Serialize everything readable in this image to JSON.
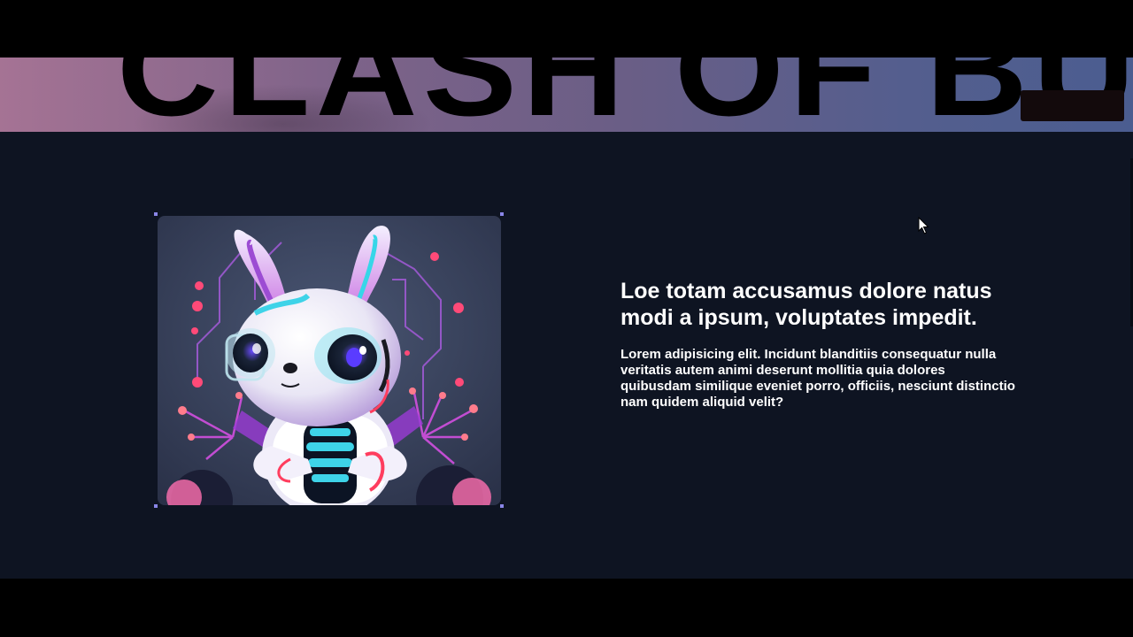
{
  "hero": {
    "title": "CLASH OF BUGS",
    "button_label": ""
  },
  "feature": {
    "image_alt_icon": "robot-bunny-illustration",
    "heading": "Loe totam accusamus dolore natus modi a ipsum, voluptates impedit.",
    "body": "Lorem adipisicing elit. Incidunt blanditiis consequatur nulla veritatis autem animi deserunt mollitia quia dolores quibusdam similique eveniet porro, officiis, nesciunt distinctio nam quidem aliquid velit?"
  },
  "colors": {
    "page_background": "#0e1422",
    "hero_gradient_start": "#a57394",
    "hero_gradient_end": "#4b5d90",
    "selection_handle": "#8a86e8",
    "hero_button": "#130a0c",
    "text": "#ffffff"
  }
}
